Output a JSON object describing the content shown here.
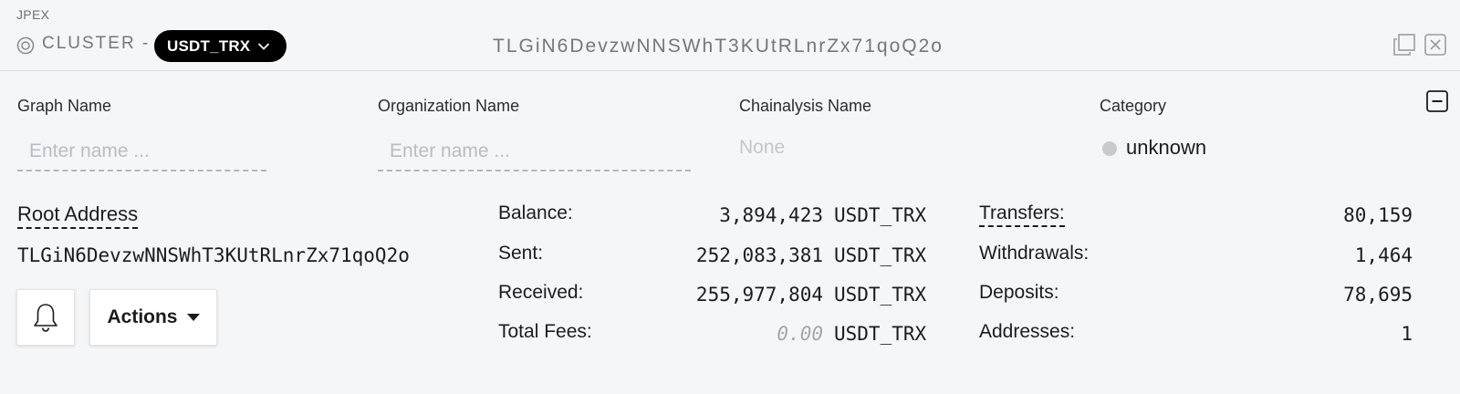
{
  "brand": "JPEX",
  "header": {
    "cluster_label": "CLUSTER -",
    "asset": "USDT_TRX",
    "address": "TLGiN6DevzwNNSWhT3KUtRLnrZx71qoQ2o"
  },
  "fields": {
    "graph_name": {
      "label": "Graph Name",
      "placeholder": "Enter name ..."
    },
    "organization_name": {
      "label": "Organization Name",
      "placeholder": "Enter name ..."
    },
    "chainalysis_name": {
      "label": "Chainalysis Name",
      "value": "None"
    },
    "category": {
      "label": "Category",
      "value": "unknown",
      "dot_color": "#c8cacd"
    }
  },
  "root": {
    "label": "Root Address",
    "address": "TLGiN6DevzwNNSWhT3KUtRLnrZx71qoQ2o"
  },
  "buttons": {
    "actions_label": "Actions"
  },
  "balances": [
    {
      "label": "Balance:",
      "value": "3,894,423",
      "unit": "USDT_TRX"
    },
    {
      "label": "Sent:",
      "value": "252,083,381",
      "unit": "USDT_TRX"
    },
    {
      "label": "Received:",
      "value": "255,977,804",
      "unit": "USDT_TRX"
    },
    {
      "label": "Total Fees:",
      "value": "0.00",
      "unit": "USDT_TRX"
    }
  ],
  "counts": [
    {
      "label": "Transfers:",
      "value": "80,159"
    },
    {
      "label": "Withdrawals:",
      "value": "1,464"
    },
    {
      "label": "Deposits:",
      "value": "78,695"
    },
    {
      "label": "Addresses:",
      "value": "1"
    }
  ],
  "icons": {
    "cluster": "target-icon",
    "asset_dropdown": "chevron-down-icon",
    "copy": "copy-icon",
    "close": "close-icon",
    "collapse": "minus-square-icon",
    "bell": "bell-icon",
    "actions_caret": "caret-down-icon"
  },
  "colors": {
    "background": "#f5f6f8",
    "pill": "#000000",
    "muted_text": "#74777d"
  }
}
